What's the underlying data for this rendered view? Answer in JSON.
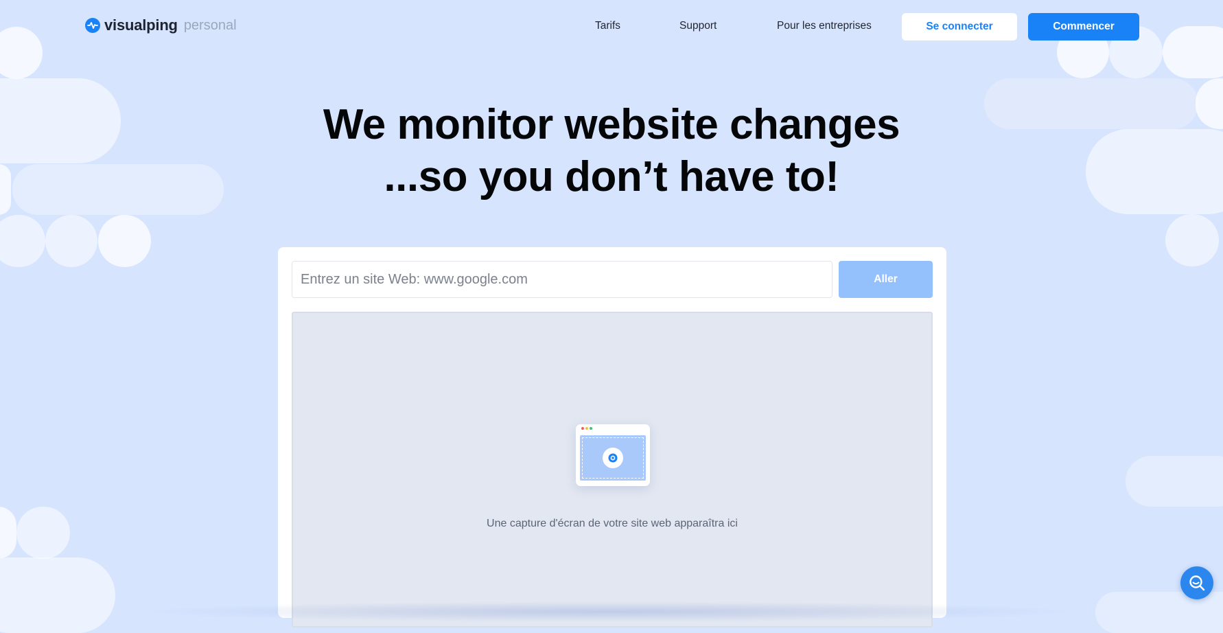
{
  "brand": {
    "name": "visualping",
    "suffix": "personal",
    "accent_color": "#1a82f7",
    "icon": "pulse-logo-icon"
  },
  "nav": {
    "items": [
      {
        "label": "Tarifs"
      },
      {
        "label": "Support"
      },
      {
        "label": "Pour les entreprises"
      }
    ],
    "login_label": "Se connecter",
    "start_label": "Commencer"
  },
  "hero": {
    "line1": "We monitor website changes",
    "line2": "...so you don’t have to!"
  },
  "search": {
    "placeholder": "Entrez un site Web: www.google.com",
    "value": "",
    "go_label": "Aller"
  },
  "preview": {
    "icon": "browser-camera-icon",
    "message": "Une capture d'écran de votre site web apparaîtra ici"
  },
  "chat": {
    "icon": "search-chat-icon"
  }
}
